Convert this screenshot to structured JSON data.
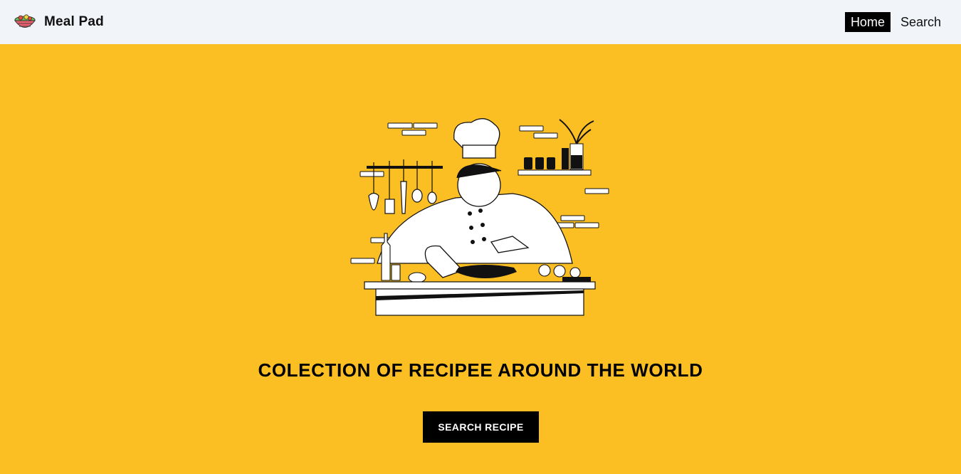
{
  "navbar": {
    "brand_name": "Meal Pad",
    "logo_icon": "salad-bowl-icon",
    "links": [
      {
        "label": "Home",
        "active": true
      },
      {
        "label": "Search",
        "active": false
      }
    ]
  },
  "hero": {
    "illustration": "chef-cooking-illustration",
    "title": "COLECTION OF RECIPEE AROUND THE WORLD",
    "cta_label": "SEARCH RECIPE"
  },
  "colors": {
    "background": "#fbbf24",
    "navbar": "#f1f4f9",
    "button": "#000000",
    "active_link": "#000000"
  }
}
